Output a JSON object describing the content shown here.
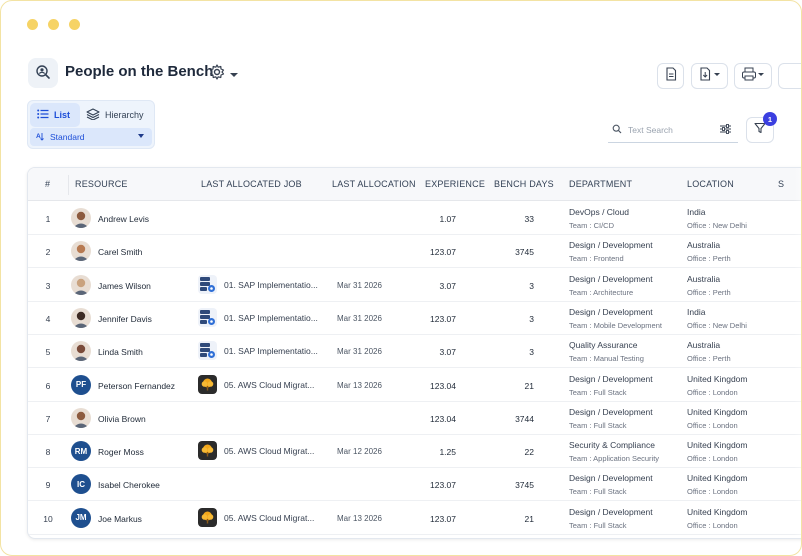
{
  "header": {
    "title": "People on the Bench"
  },
  "view": {
    "tabs": [
      {
        "label": "List",
        "icon": "list-icon",
        "active": true
      },
      {
        "label": "Hierarchy",
        "icon": "layers-icon",
        "active": false
      }
    ],
    "selected_view": "Standard"
  },
  "search": {
    "placeholder": "Text Search"
  },
  "filter": {
    "badge_count": "1"
  },
  "colors": {
    "accent": "#1d4ed8",
    "avatar_initials_bg": "#1e4f8f",
    "badge": "#3b3fe0",
    "window_dots": "#f6d365"
  },
  "table": {
    "columns": [
      "#",
      "RESOURCE",
      "LAST ALLOCATED JOB",
      "LAST ALLOCATION",
      "EXPERIENCE",
      "BENCH DAYS",
      "DEPARTMENT",
      "LOCATION",
      "S"
    ],
    "rows": [
      {
        "num": "1",
        "name": "Andrew Levis",
        "avatar": "photo",
        "initials": "",
        "job": "",
        "job_icon": "",
        "date": "",
        "experience": "1.07",
        "bench_days": "33",
        "department": "DevOps / Cloud",
        "team": "Team : CI/CD",
        "location": "India",
        "office": "Office : New Delhi"
      },
      {
        "num": "2",
        "name": "Carel Smith",
        "avatar": "photo",
        "initials": "",
        "job": "",
        "job_icon": "",
        "date": "",
        "experience": "123.07",
        "bench_days": "3745",
        "department": "Design / Development",
        "team": "Team : Frontend",
        "location": "Australia",
        "office": "Office : Perth"
      },
      {
        "num": "3",
        "name": "James Wilson",
        "avatar": "photo",
        "initials": "",
        "job": "01. SAP Implementatio...",
        "job_icon": "server-gear-icon",
        "date": "Mar 31 2026",
        "experience": "3.07",
        "bench_days": "3",
        "department": "Design / Development",
        "team": "Team : Architecture",
        "location": "Australia",
        "office": "Office : Perth"
      },
      {
        "num": "4",
        "name": "Jennifer Davis",
        "avatar": "photo",
        "initials": "",
        "job": "01. SAP Implementatio...",
        "job_icon": "server-gear-icon",
        "date": "Mar 31 2026",
        "experience": "123.07",
        "bench_days": "3",
        "department": "Design / Development",
        "team": "Team : Mobile Development",
        "location": "India",
        "office": "Office : New Delhi"
      },
      {
        "num": "5",
        "name": "Linda Smith",
        "avatar": "photo",
        "initials": "",
        "job": "01. SAP Implementatio...",
        "job_icon": "server-gear-icon",
        "date": "Mar 31 2026",
        "experience": "3.07",
        "bench_days": "3",
        "department": "Quality Assurance",
        "team": "Team : Manual Testing",
        "location": "Australia",
        "office": "Office : Perth"
      },
      {
        "num": "6",
        "name": "Peterson Fernandez",
        "avatar": "initials",
        "initials": "PF",
        "job": "05. AWS Cloud Migrat...",
        "job_icon": "cloud-tree-icon",
        "date": "Mar 13 2026",
        "experience": "123.04",
        "bench_days": "21",
        "department": "Design / Development",
        "team": "Team : Full Stack",
        "location": "United Kingdom",
        "office": "Office : London"
      },
      {
        "num": "7",
        "name": "Olivia Brown",
        "avatar": "photo",
        "initials": "",
        "job": "",
        "job_icon": "",
        "date": "",
        "experience": "123.04",
        "bench_days": "3744",
        "department": "Design / Development",
        "team": "Team : Full Stack",
        "location": "United Kingdom",
        "office": "Office : London"
      },
      {
        "num": "8",
        "name": "Roger Moss",
        "avatar": "initials",
        "initials": "RM",
        "job": "05. AWS Cloud Migrat...",
        "job_icon": "cloud-tree-icon",
        "date": "Mar 12 2026",
        "experience": "1.25",
        "bench_days": "22",
        "department": "Security & Compliance",
        "team": "Team : Application Security",
        "location": "United Kingdom",
        "office": "Office : London"
      },
      {
        "num": "9",
        "name": "Isabel Cherokee",
        "avatar": "initials",
        "initials": "IC",
        "job": "",
        "job_icon": "",
        "date": "",
        "experience": "123.07",
        "bench_days": "3745",
        "department": "Design / Development",
        "team": "Team : Full Stack",
        "location": "United Kingdom",
        "office": "Office : London"
      },
      {
        "num": "10",
        "name": "Joe Markus",
        "avatar": "initials",
        "initials": "JM",
        "job": "05. AWS Cloud Migrat...",
        "job_icon": "cloud-tree-icon",
        "date": "Mar 13 2026",
        "experience": "123.07",
        "bench_days": "21",
        "department": "Design / Development",
        "team": "Team : Full Stack",
        "location": "United Kingdom",
        "office": "Office : London"
      }
    ]
  }
}
